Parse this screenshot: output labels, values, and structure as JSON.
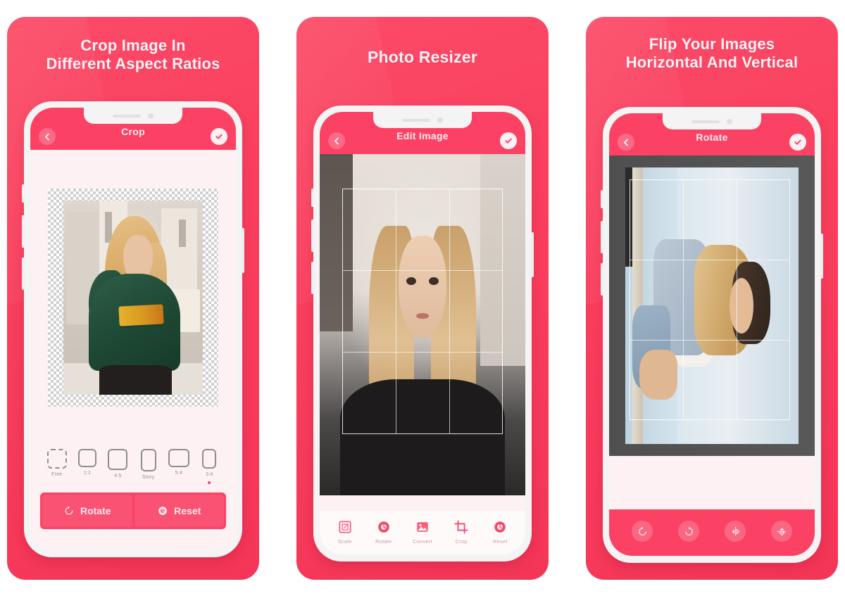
{
  "theme": {
    "accent": "#fb4264",
    "accent_dark": "#f43558",
    "screen_bg": "#fdf1f3",
    "canvas_dark": "#4d4d4d",
    "toolbar_bg": "#fffafa",
    "label_muted": "#c8a0a8"
  },
  "panels": [
    {
      "promo_title": "Crop Image In\nDifferent Aspect Ratios",
      "appbar": {
        "title": "Crop",
        "back_icon": "chevron-left-icon",
        "confirm_icon": "check-icon"
      },
      "ratios": [
        {
          "label": "Free",
          "selected": false
        },
        {
          "label": "1:1",
          "selected": false
        },
        {
          "label": "4:5",
          "selected": false
        },
        {
          "label": "Story",
          "selected": false
        },
        {
          "label": "5:4",
          "selected": false
        },
        {
          "label": "3:4",
          "selected": true
        }
      ],
      "actions": [
        {
          "label": "Rotate",
          "icon": "rotate-left-icon"
        },
        {
          "label": "Reset",
          "icon": "reset-icon"
        }
      ]
    },
    {
      "promo_title": "Photo Resizer",
      "appbar": {
        "title": "Edit Image",
        "back_icon": "chevron-left-icon",
        "confirm_icon": "check-icon"
      },
      "toolbar": [
        {
          "label": "Scale",
          "icon": "scale-icon"
        },
        {
          "label": "Rotate",
          "icon": "rotate-icon"
        },
        {
          "label": "Convert",
          "icon": "image-icon"
        },
        {
          "label": "Crop",
          "icon": "crop-icon"
        },
        {
          "label": "Reset",
          "icon": "reset-icon"
        }
      ]
    },
    {
      "promo_title": "Flip Your Images\nHorizontal And Vertical",
      "appbar": {
        "title": "Rotate",
        "back_icon": "chevron-left-icon",
        "confirm_icon": "check-icon"
      },
      "flip_buttons": [
        {
          "name": "rotate-left-icon"
        },
        {
          "name": "rotate-right-icon"
        },
        {
          "name": "flip-horizontal-icon"
        },
        {
          "name": "flip-vertical-icon"
        }
      ]
    }
  ]
}
